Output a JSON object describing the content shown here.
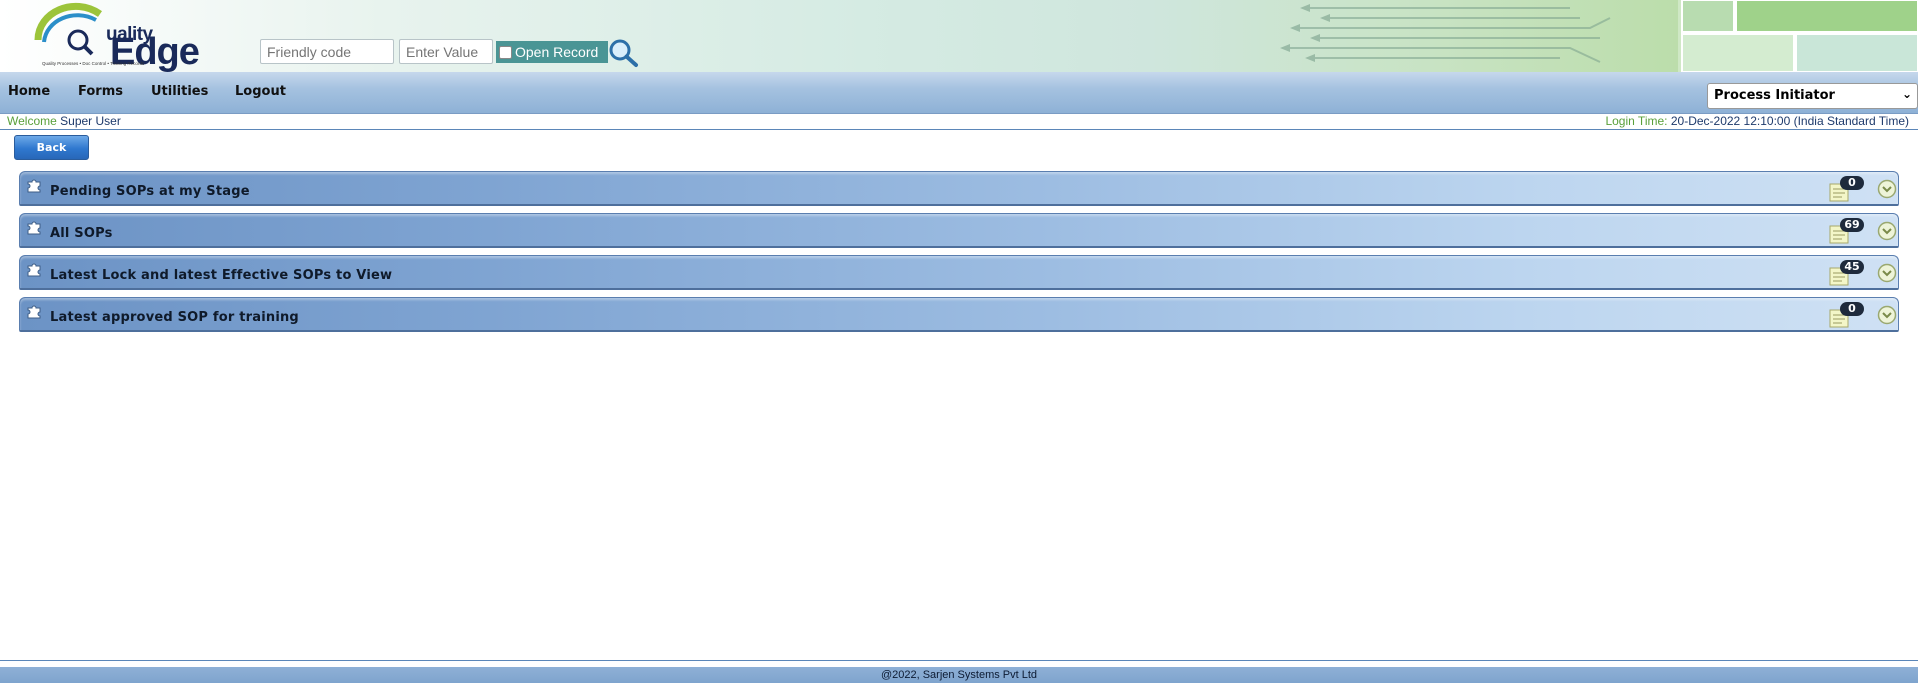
{
  "logo": {
    "brand_top": "uality",
    "brand_bottom": "Edge",
    "tagline": "Quality Processes • Doc Control • Training Records"
  },
  "search": {
    "friendly_placeholder": "Friendly code",
    "value_placeholder": "Enter Value",
    "open_record_label": "Open Record"
  },
  "nav": {
    "items": [
      {
        "label": "Home"
      },
      {
        "label": "Forms"
      },
      {
        "label": "Utilities"
      },
      {
        "label": "Logout"
      }
    ],
    "role_selected": "Process Initiator"
  },
  "session": {
    "welcome_label": "Welcome",
    "user_name": "Super User",
    "login_label": "Login Time:",
    "login_time": "20-Dec-2022 12:10:00 (India Standard Time)"
  },
  "back_label": "Back",
  "panels": [
    {
      "title": "Pending SOPs at my Stage",
      "count": "0"
    },
    {
      "title": "All SOPs",
      "count": "69"
    },
    {
      "title": "Latest Lock and latest Effective SOPs to View",
      "count": "45"
    },
    {
      "title": "Latest approved SOP for training",
      "count": "0"
    }
  ],
  "footer": "@2022, Sarjen Systems Pvt Ltd",
  "colors": {
    "nav_blue": "#8eb1d6",
    "panel_blue": "#6c93c5",
    "welcome_green": "#5aa03a",
    "open_record_teal": "#4a9595",
    "badge_dark": "#1e2a3c"
  }
}
